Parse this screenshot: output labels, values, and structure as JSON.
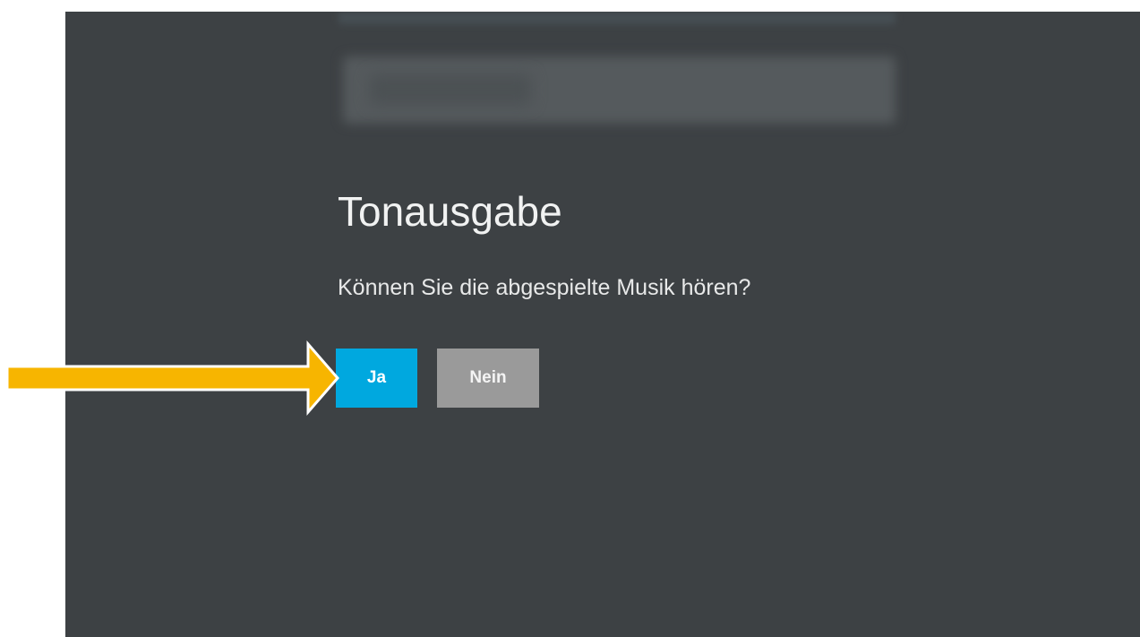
{
  "dialog": {
    "title": "Tonausgabe",
    "question": "Können Sie die abgespielte Musik hören?",
    "yes_label": "Ja",
    "no_label": "Nein"
  },
  "colors": {
    "screen_background": "#3d4144",
    "yes_button": "#00a8df",
    "no_button": "#9a9a9a",
    "annotation_arrow": "#f7b500"
  },
  "annotation": {
    "icon": "arrow-right-icon",
    "points_to": "yes-button"
  }
}
